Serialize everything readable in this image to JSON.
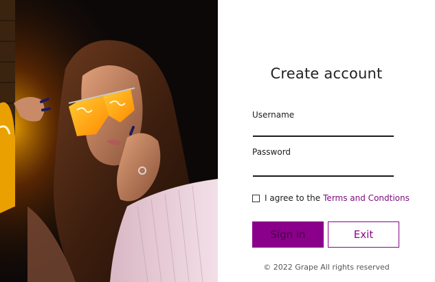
{
  "left_image": {
    "description_icon": "neon-portrait-photo"
  },
  "form": {
    "title": "Create account",
    "username_label": "Username",
    "username_value": "",
    "password_label": "Password",
    "password_value": "",
    "agree_text": "I agree to the",
    "terms_link": "Terms and Condtions",
    "agree_checked": false,
    "signin_label": "Sign in",
    "exit_label": "Exit",
    "footer": "© 2022 Grape All rights reserved"
  },
  "colors": {
    "accent": "#8b008b",
    "link": "#7b0a7b",
    "text": "#1b1b1b"
  }
}
